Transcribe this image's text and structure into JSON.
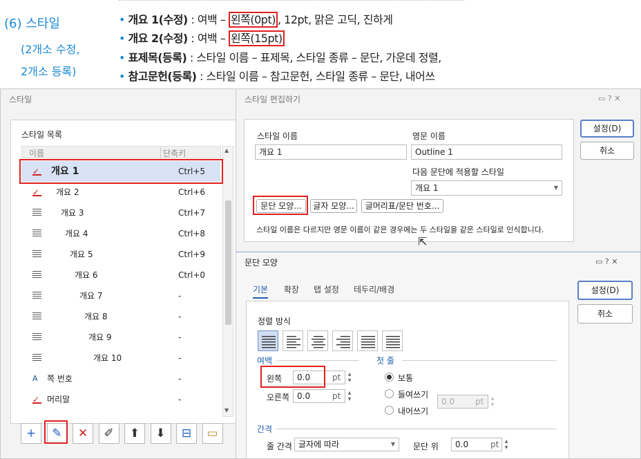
{
  "header": {
    "section_num": "(6) 스타일",
    "section_sub1": "(2개소 수정,",
    "section_sub2": "2개소 등록)",
    "lines": [
      {
        "bold": "개요 1(수정)",
        "pre": " : 여백 – ",
        "box": "왼쪽(0pt)",
        "post": ", 12pt, 맑은 고딕, 진하게"
      },
      {
        "bold": "개요 2(수정)",
        "pre": " : 여백 – ",
        "box": "왼쪽(15pt)",
        "post": ""
      },
      {
        "bold": "표제목(등록)",
        "pre": " : 스타일 이름 – 표제목, 스타일 종류 – 문단, 가운데 정렬,",
        "box": "",
        "post": ""
      },
      {
        "bold": "참고문헌(등록)",
        "pre": " : 스타일 이름 – 참고문헌, 스타일 종류 – 문단, 내어쓰",
        "box": "",
        "post": ""
      }
    ]
  },
  "style_dialog": {
    "title": "스타일",
    "list_label": "스타일 목록",
    "col_name": "이름",
    "col_shortcut": "단축키",
    "items": [
      {
        "name": "개요 1",
        "shortcut": "Ctrl+5",
        "icon": "check-icon",
        "selected": true
      },
      {
        "name": "개요 2",
        "shortcut": "Ctrl+6",
        "icon": "check-icon"
      },
      {
        "name": "개요 3",
        "shortcut": "Ctrl+7",
        "icon": "paragraph-icon"
      },
      {
        "name": "개요 4",
        "shortcut": "Ctrl+8",
        "icon": "paragraph-icon"
      },
      {
        "name": "개요 5",
        "shortcut": "Ctrl+9",
        "icon": "paragraph-icon"
      },
      {
        "name": "개요 6",
        "shortcut": "Ctrl+0",
        "icon": "paragraph-icon"
      },
      {
        "name": "개요 7",
        "shortcut": "-",
        "icon": "paragraph-icon"
      },
      {
        "name": "개요 8",
        "shortcut": "-",
        "icon": "paragraph-icon"
      },
      {
        "name": "개요 9",
        "shortcut": "-",
        "icon": "paragraph-icon"
      },
      {
        "name": "개요 10",
        "shortcut": "-",
        "icon": "paragraph-icon"
      },
      {
        "name": "쪽 번호",
        "shortcut": "-",
        "icon": "char-style-icon"
      },
      {
        "name": "머리말",
        "shortcut": "-",
        "icon": "check-icon"
      }
    ],
    "tools": [
      "add-icon",
      "edit-pencil-icon",
      "delete-icon",
      "edit-style-icon",
      "move-up-icon",
      "move-down-icon",
      "import-icon",
      "folder-icon"
    ]
  },
  "edit_dialog": {
    "title": "스타일 편집하기",
    "name_label": "스타일 이름",
    "name_value": "개요 1",
    "eng_label": "영문 이름",
    "eng_value": "Outline 1",
    "next_label": "다음 문단에 적용할 스타일",
    "next_value": "개요 1",
    "btn_para": "문단 모양...",
    "btn_char": "글자 모양...",
    "btn_bullet": "글머리표/문단 번호...",
    "note": "스타일 이름은 다르지만 영문 이름이 같은 경우에는 두 스타일을 같은 스타일로 인식합니다.",
    "ok": "설정(D)",
    "cancel": "취소"
  },
  "para_dialog": {
    "title": "문단 모양",
    "tabs": [
      "기본",
      "확장",
      "탭 설정",
      "테두리/배경"
    ],
    "align_label": "정렬 방식",
    "margin_label": "여백",
    "left_label": "왼쪽",
    "left_value": "0.0",
    "right_label": "오른쪽",
    "right_value": "0.0",
    "unit": "pt",
    "first_label": "첫 줄",
    "radio_normal": "보통",
    "radio_indent": "들여쓰기",
    "radio_hanging": "내어쓰기",
    "indent_value": "0.0",
    "spacing_label": "간격",
    "line_label": "줄 간격",
    "line_value": "글자에 따라",
    "above_label": "문단 위",
    "above_value": "0.0",
    "ok": "설정(D)",
    "cancel": "취소"
  }
}
